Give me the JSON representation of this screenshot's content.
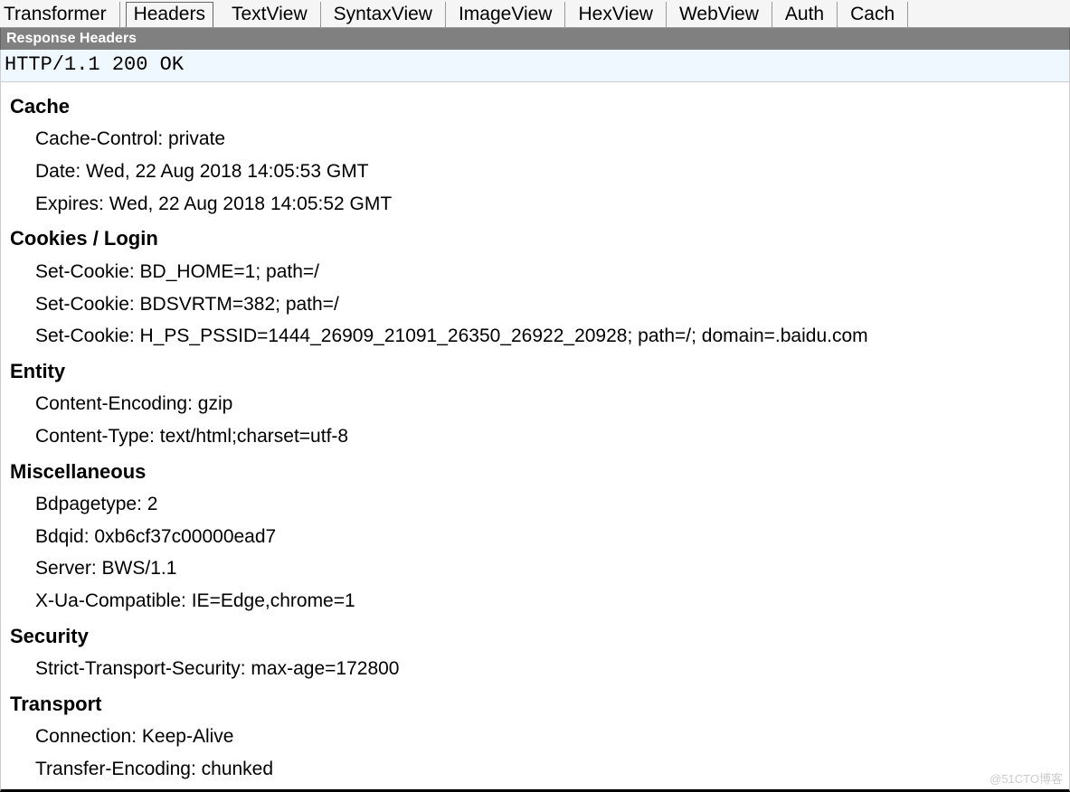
{
  "tabs": [
    {
      "label": "Transformer",
      "active": false
    },
    {
      "label": "Headers",
      "active": true
    },
    {
      "label": "TextView",
      "active": false
    },
    {
      "label": "SyntaxView",
      "active": false
    },
    {
      "label": "ImageView",
      "active": false
    },
    {
      "label": "HexView",
      "active": false
    },
    {
      "label": "WebView",
      "active": false
    },
    {
      "label": "Auth",
      "active": false
    },
    {
      "label": "Cach",
      "active": false
    }
  ],
  "sectionHeader": "Response Headers",
  "statusLine": "HTTP/1.1 200 OK",
  "groups": [
    {
      "title": "Cache",
      "headers": [
        "Cache-Control: private",
        "Date: Wed, 22 Aug 2018 14:05:53 GMT",
        "Expires: Wed, 22 Aug 2018 14:05:52 GMT"
      ]
    },
    {
      "title": "Cookies / Login",
      "headers": [
        "Set-Cookie: BD_HOME=1; path=/",
        "Set-Cookie: BDSVRTM=382; path=/",
        "Set-Cookie: H_PS_PSSID=1444_26909_21091_26350_26922_20928; path=/; domain=.baidu.com"
      ]
    },
    {
      "title": "Entity",
      "headers": [
        "Content-Encoding: gzip",
        "Content-Type: text/html;charset=utf-8"
      ]
    },
    {
      "title": "Miscellaneous",
      "headers": [
        "Bdpagetype: 2",
        "Bdqid: 0xb6cf37c00000ead7",
        "Server: BWS/1.1",
        "X-Ua-Compatible: IE=Edge,chrome=1"
      ]
    },
    {
      "title": "Security",
      "headers": [
        "Strict-Transport-Security: max-age=172800"
      ]
    },
    {
      "title": "Transport",
      "headers": [
        "Connection: Keep-Alive",
        "Transfer-Encoding: chunked"
      ]
    }
  ],
  "watermark": "@51CTO博客"
}
